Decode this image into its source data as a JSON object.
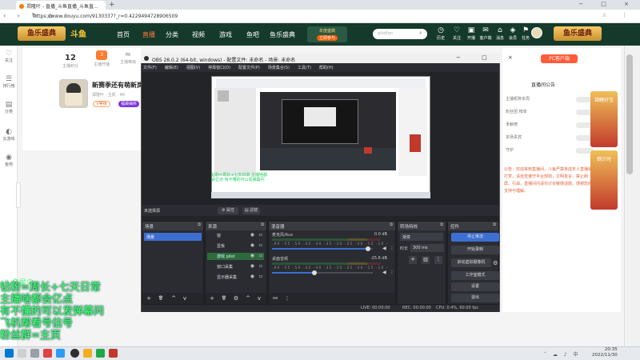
{
  "browser": {
    "tab_title": "郑隆叶 - 直播_斗鱼直播_斗鱼直...",
    "new_tab": "+",
    "window_controls": "− □ ×",
    "nav_glyphs": "‹ › ↻ ⌂",
    "url": "https://www.douyu.com/9130337?_r=0.4229494728906509",
    "url_icons": "☆ ⋮"
  },
  "header": {
    "banner_left": "鱼乐盛典",
    "logo": "斗鱼",
    "nav": [
      "首页",
      "直播",
      "分类",
      "视频",
      "游戏",
      "鱼吧",
      "鱼乐盛典"
    ],
    "active_nav_index": 1,
    "promo_text": "年度盛典",
    "promo_btn": "立即参与",
    "search_placeholder": "pilotfan",
    "search_icon": "⌕",
    "icons": [
      {
        "glyph": "◷",
        "label": "历史"
      },
      {
        "glyph": "♡",
        "label": "关注"
      },
      {
        "glyph": "▣",
        "label": "开播"
      },
      {
        "glyph": "✉",
        "label": "客户端"
      },
      {
        "glyph": "⌂",
        "label": "消息"
      },
      {
        "glyph": "◈",
        "label": "会员"
      },
      {
        "glyph": "⚑",
        "label": "任务"
      }
    ],
    "banner_right": "鱼乐盛典",
    "accent": "#ff5c00"
  },
  "left_sidebar": [
    {
      "glyph": "♡",
      "label": "关注"
    },
    {
      "glyph": "☰",
      "label": "排行榜"
    },
    {
      "glyph": "▤",
      "label": "分类"
    },
    {
      "glyph": "◐",
      "label": "云游戏"
    },
    {
      "glyph": "◉",
      "label": "鱼吧"
    }
  ],
  "room": {
    "stat_value": "12",
    "stat_label": "主播积分",
    "badge2_label": "主播开播",
    "badge2_icon": "3",
    "badge3_label": "主播等级",
    "title": "新赛季还有萌新岚",
    "meta": "郑隆叶  ·  主机  ·  46",
    "tag1": "V等级",
    "tag2": "福袋抽奖"
  },
  "right_panel": {
    "pc_button": "PC客户端",
    "rank_label": "直播间公告",
    "rows": [
      "主播昵称本周",
      "粉丝团 榜单",
      "贡献榜",
      "本场贵宾",
      "守护"
    ],
    "notice": "公告：欢迎来到直播间，斗鱼严禁未成年人直播或打赏，请自觉遵守平台规则，文明发言，禁止刷屏、引战，直播间内请勿讨论敏感话题，感谢您的支持与理解。",
    "side_banner1": "锦鲤好宝",
    "side_banner2": "倒计时"
  },
  "obs": {
    "title": "OBS 28.0.2 (64-bit, windows) - 配置文件: 未命名 - 场景: 未命名",
    "win_controls": "− □ ×",
    "menu": [
      "文件(F)",
      "编辑(E)",
      "视图(V)",
      "停靠窗口(D)",
      "配置文件(P)",
      "场景集合(S)",
      "工具(T)",
      "帮助(H)"
    ],
    "preview_green": "钻粉=周长+七天日常 主播啥都会亿点 有不懂的可以发弹幕问",
    "no_source": "未选择源",
    "properties_btn": "⚙ 属性",
    "filters_btn": "▤ 滤镜",
    "docks": {
      "scenes": {
        "title": "场景",
        "items": [
          "场景"
        ]
      },
      "sources": {
        "title": "来源",
        "items": [
          "窗",
          "显板",
          "游戏 pilot",
          "窗口采集",
          "显示器采集"
        ]
      },
      "mixer": {
        "title": "混音器",
        "tracks": [
          {
            "name": "麦克风/Aux",
            "db": "0.0 dB",
            "level": 0.95
          },
          {
            "name": "桌面音频",
            "db": "-25.6 dB",
            "level": 0.42
          }
        ],
        "scale": "-60 -55 -50 -45 -40 -35 -30 -25 -20 -15 -10 -5 0"
      },
      "transitions": {
        "title": "转场特效",
        "type": "渐变",
        "duration_label": "时长",
        "duration": "300 ms"
      },
      "controls": {
        "title": "控件",
        "buttons": [
          "停止推流",
          "开始录制",
          "启动虚拟摄像机",
          "工作室模式",
          "设置",
          "退出"
        ]
      }
    },
    "dock_close": "⧉",
    "tool_glyphs": [
      "+",
      "🗑",
      "^",
      "v"
    ],
    "status": {
      "live": "LIVE: 00:00:00",
      "rec": "REC: 00:00:00",
      "cpu": "CPU: 0.4%, 60.00 fps"
    }
  },
  "danmu": {
    "top": "\\\\ 名星尖",
    "lines": [
      "钻粉=周长+七天日常",
      "主播啥都会亿点",
      "有不懂的可以发弹幕问",
      "飞机帮看号估号",
      "粉丝群=主页"
    ]
  },
  "taskbar": {
    "tray": "ˆ ☁ ♪ 中",
    "time": "20:35",
    "date": "2022/11/30"
  }
}
